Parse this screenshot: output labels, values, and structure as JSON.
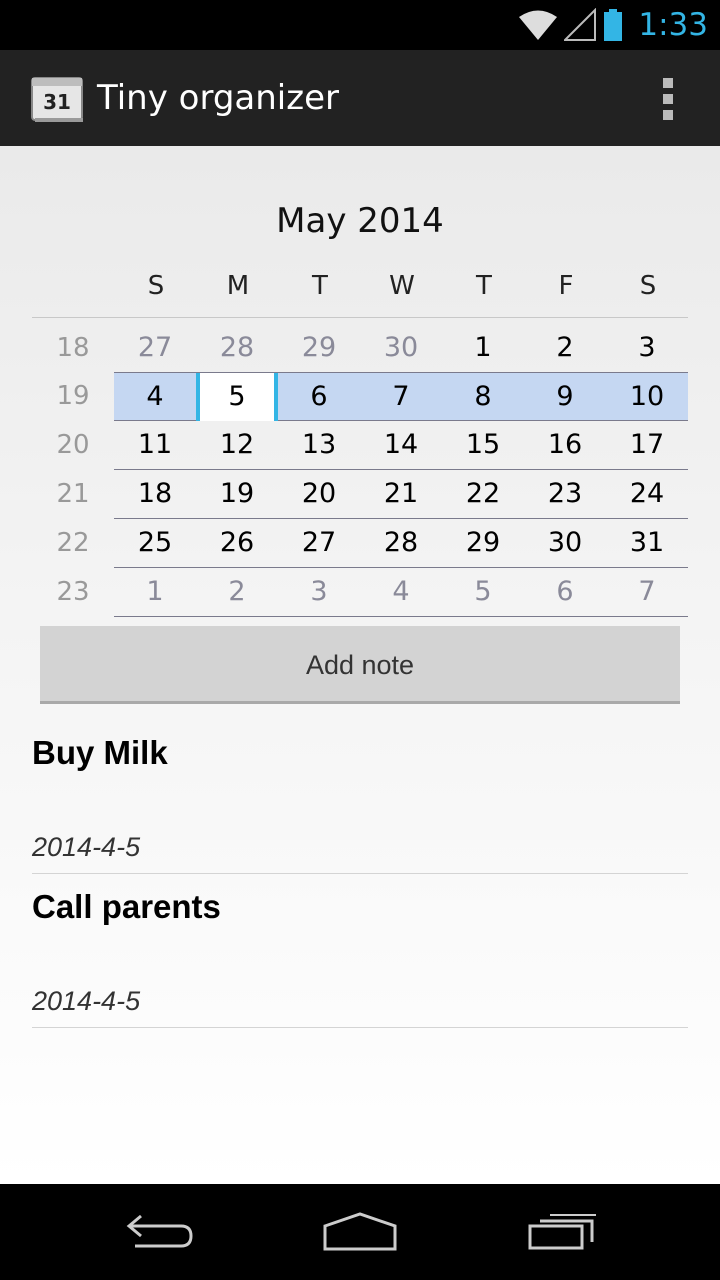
{
  "status": {
    "time": "1:33"
  },
  "app": {
    "title": "Tiny organizer",
    "icon_day": "31"
  },
  "calendar": {
    "month_label": "May 2014",
    "weekdays": [
      "S",
      "M",
      "T",
      "W",
      "T",
      "F",
      "S"
    ],
    "weeks": [
      {
        "num": "18",
        "days": [
          "27",
          "28",
          "29",
          "30",
          "1",
          "2",
          "3"
        ]
      },
      {
        "num": "19",
        "days": [
          "4",
          "5",
          "6",
          "7",
          "8",
          "9",
          "10"
        ]
      },
      {
        "num": "20",
        "days": [
          "11",
          "12",
          "13",
          "14",
          "15",
          "16",
          "17"
        ]
      },
      {
        "num": "21",
        "days": [
          "18",
          "19",
          "20",
          "21",
          "22",
          "23",
          "24"
        ]
      },
      {
        "num": "22",
        "days": [
          "25",
          "26",
          "27",
          "28",
          "29",
          "30",
          "31"
        ]
      },
      {
        "num": "23",
        "days": [
          "1",
          "2",
          "3",
          "4",
          "5",
          "6",
          "7"
        ]
      }
    ]
  },
  "add_note_label": "Add note",
  "notes": [
    {
      "title": "Buy Milk",
      "date": "2014-4-5"
    },
    {
      "title": "Call parents",
      "date": "2014-4-5"
    }
  ],
  "colors": {
    "accent": "#33b5e5",
    "selected_week": "#c5d7f2",
    "action_bar": "#222222"
  },
  "icons": {
    "status": [
      "wifi-icon",
      "signal-icon",
      "battery-icon"
    ],
    "nav": [
      "back-icon",
      "home-icon",
      "recent-apps-icon"
    ],
    "menu": "overflow-menu-icon"
  }
}
